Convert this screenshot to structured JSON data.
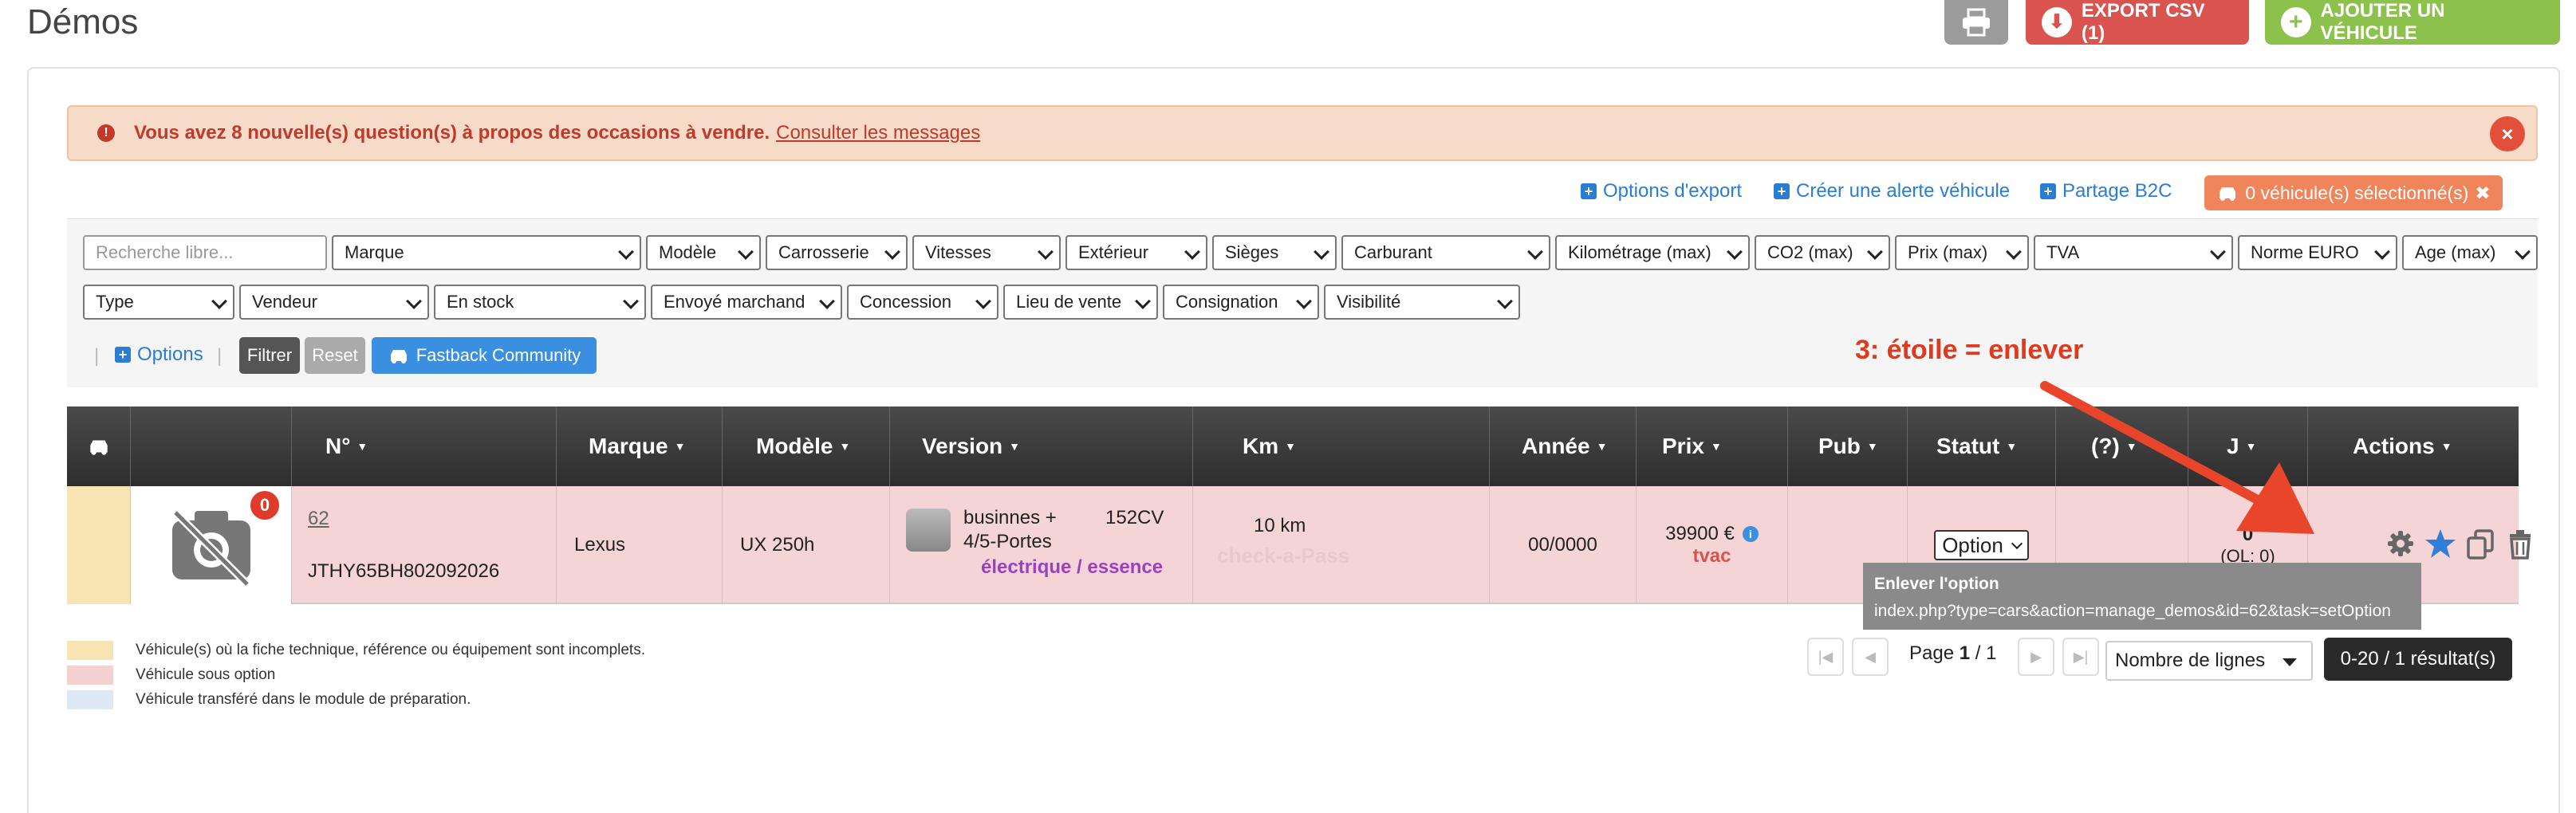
{
  "page_title": "Démos",
  "toolbar": {
    "export_label": "EXPORT CSV (1)",
    "add_label": "AJOUTER UN VÉHICULE"
  },
  "alert": {
    "message": "Vous avez 8 nouvelle(s) question(s) à propos des occasions à vendre.",
    "link": "Consulter les messages",
    "close": "×"
  },
  "top_links": {
    "export_options": "Options d'export",
    "create_alert": "Créer une alerte véhicule",
    "share_b2c": "Partage B2C",
    "selected": "0 véhicule(s) sélectionné(s)",
    "selected_close": "✖"
  },
  "filters": {
    "search_placeholder": "Recherche libre...",
    "row1": [
      "Marque",
      "Modèle",
      "Carrosserie",
      "Vitesses",
      "Extérieur",
      "Sièges",
      "Carburant",
      "Kilométrage (max)",
      "CO2 (max)",
      "Prix (max)",
      "TVA",
      "Norme EURO",
      "Age (max)"
    ],
    "row2": [
      "Type",
      "Vendeur",
      "En stock",
      "Envoyé marchand",
      "Concession",
      "Lieu de vente",
      "Consignation",
      "Visibilité"
    ],
    "options": "Options",
    "filter": "Filtrer",
    "reset": "Reset",
    "community": "Fastback Community"
  },
  "annotation": "3: étoile = enlever",
  "table": {
    "headers": [
      "N°",
      "Marque",
      "Modèle",
      "Version",
      "Km",
      "Année",
      "Prix",
      "Pub",
      "Statut",
      "(?)",
      "J",
      "Actions"
    ],
    "row": {
      "badge": "0",
      "number": "62",
      "vin": "JTHY65BH802092026",
      "brand": "Lexus",
      "model": "UX 250h",
      "version_line1": "businnes +",
      "version_line2": "4/5-Portes",
      "power": "152CV",
      "fuel": "électrique / essence",
      "km": "10 km",
      "km_watermark": "check-a-Pass",
      "year": "00/0000",
      "price": "39900 €",
      "price_note": "tvac",
      "status": "Option",
      "days": "0",
      "days_sub": "(OL: 0)"
    }
  },
  "tooltip": {
    "title": "Enlever l'option",
    "url": "index.php?type=cars&action=manage_demos&id=62&task=setOption"
  },
  "legend": [
    {
      "label": "Véhicule(s) où la fiche technique, référence ou équipement sont incomplets.",
      "color": "#f8e3b3"
    },
    {
      "label": "Véhicule sous option",
      "color": "#f4d0d0"
    },
    {
      "label": "Véhicule transféré dans le module de préparation.",
      "color": "#dfe8f5"
    }
  ],
  "pagination": {
    "page_label": "Page",
    "page": "1",
    "total": "/ 1",
    "rows_label": "Nombre de lignes",
    "results": "0-20 / 1 résultat(s)"
  }
}
